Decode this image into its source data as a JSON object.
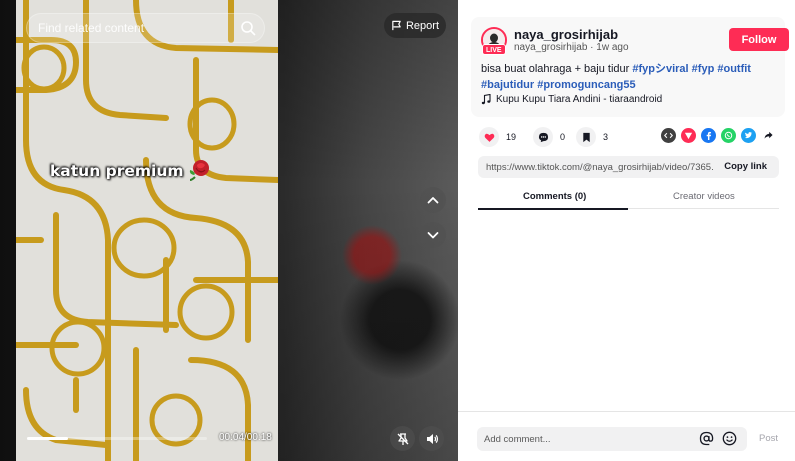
{
  "video": {
    "search_placeholder": "Find related content",
    "report_label": "Report",
    "overlay_caption": "katun premium",
    "progress_fraction": 0.23,
    "time": "00:04/00:18",
    "icons": {
      "search": "search-icon",
      "report": "flag-icon",
      "caption_emoji": "rose-icon",
      "previous": "chevron-up-icon",
      "next": "chevron-down-icon",
      "floating_player": "pin-icon",
      "volume": "volume-icon"
    }
  },
  "author": {
    "username": "naya_grosirhijab",
    "handle": "naya_grosirhijab",
    "separator": "·",
    "posted": "1w ago",
    "live_badge": "LIVE",
    "follow_label": "Follow"
  },
  "post": {
    "description_text": "bisa buat olahraga + baju tidur ",
    "hashtags": [
      "#fypシviral",
      "#fyp",
      "#outfit",
      "#bajutidur",
      "#promoguncang55"
    ],
    "music": "Kupu Kupu Tiara Andini - tiaraandroid"
  },
  "actions": {
    "likes": "19",
    "comments": "0",
    "saves": "3"
  },
  "share_targets": [
    {
      "name": "embed-icon",
      "color": "#404040"
    },
    {
      "name": "send-icon",
      "color": "#fe2c55"
    },
    {
      "name": "facebook-icon",
      "color": "#1877f2"
    },
    {
      "name": "whatsapp-icon",
      "color": "#25d366"
    },
    {
      "name": "twitter-icon",
      "color": "#1da1f2"
    },
    {
      "name": "share-arrow-icon",
      "color": "#161823"
    }
  ],
  "link": {
    "url": "https://www.tiktok.com/@naya_grosirhijab/video/7365...",
    "copy_label": "Copy link"
  },
  "tabs": {
    "comments": "Comments (0)",
    "creator_videos": "Creator videos"
  },
  "comment_bar": {
    "placeholder": "Add comment...",
    "post_label": "Post"
  },
  "colors": {
    "accent": "#fe2c55",
    "hashtag": "#2b5db9",
    "fabric_pattern": "#d0a21f"
  }
}
